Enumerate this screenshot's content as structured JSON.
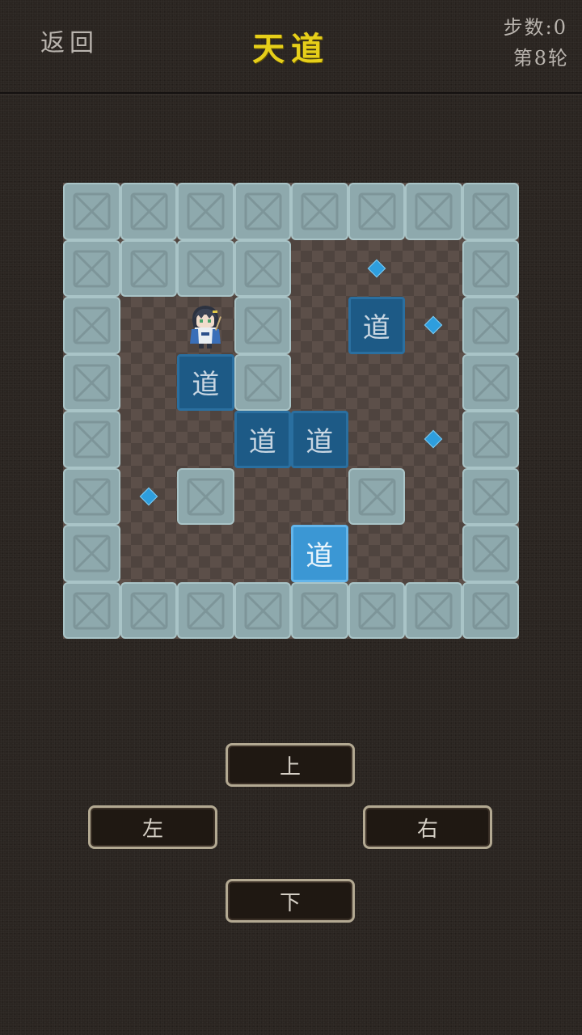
{
  "header": {
    "back_label": "返回",
    "title": "天道",
    "steps_label": "步数:0",
    "round_label": "第8轮"
  },
  "board": {
    "cols": 8,
    "rows": 8,
    "walls": [
      [
        0,
        0
      ],
      [
        1,
        0
      ],
      [
        2,
        0
      ],
      [
        3,
        0
      ],
      [
        4,
        0
      ],
      [
        5,
        0
      ],
      [
        6,
        0
      ],
      [
        7,
        0
      ],
      [
        0,
        1
      ],
      [
        1,
        1
      ],
      [
        2,
        1
      ],
      [
        3,
        1
      ],
      [
        7,
        1
      ],
      [
        0,
        2
      ],
      [
        3,
        2
      ],
      [
        7,
        2
      ],
      [
        0,
        3
      ],
      [
        3,
        3
      ],
      [
        7,
        3
      ],
      [
        0,
        4
      ],
      [
        7,
        4
      ],
      [
        0,
        5
      ],
      [
        2,
        5
      ],
      [
        5,
        5
      ],
      [
        7,
        5
      ],
      [
        0,
        6
      ],
      [
        7,
        6
      ],
      [
        0,
        7
      ],
      [
        1,
        7
      ],
      [
        2,
        7
      ],
      [
        3,
        7
      ],
      [
        4,
        7
      ],
      [
        5,
        7
      ],
      [
        6,
        7
      ],
      [
        7,
        7
      ]
    ],
    "boxes": [
      {
        "col": 5,
        "row": 2,
        "label": "道",
        "on_target": false
      },
      {
        "col": 2,
        "row": 3,
        "label": "道",
        "on_target": false
      },
      {
        "col": 3,
        "row": 4,
        "label": "道",
        "on_target": false
      },
      {
        "col": 4,
        "row": 4,
        "label": "道",
        "on_target": false
      },
      {
        "col": 4,
        "row": 6,
        "label": "道",
        "on_target": true
      }
    ],
    "targets": [
      [
        5,
        1
      ],
      [
        6,
        2
      ],
      [
        6,
        4
      ],
      [
        1,
        5
      ]
    ],
    "player": {
      "col": 2,
      "row": 2
    }
  },
  "controls": {
    "up": "上",
    "left": "左",
    "right": "右",
    "down": "下"
  },
  "colors": {
    "title": "#e6cf1a",
    "wall": "#8ea9ad",
    "box": "#1d5a86",
    "box_on_target": "#3b97d4",
    "target": "#2e9ede",
    "floor": "#5c4f49"
  }
}
